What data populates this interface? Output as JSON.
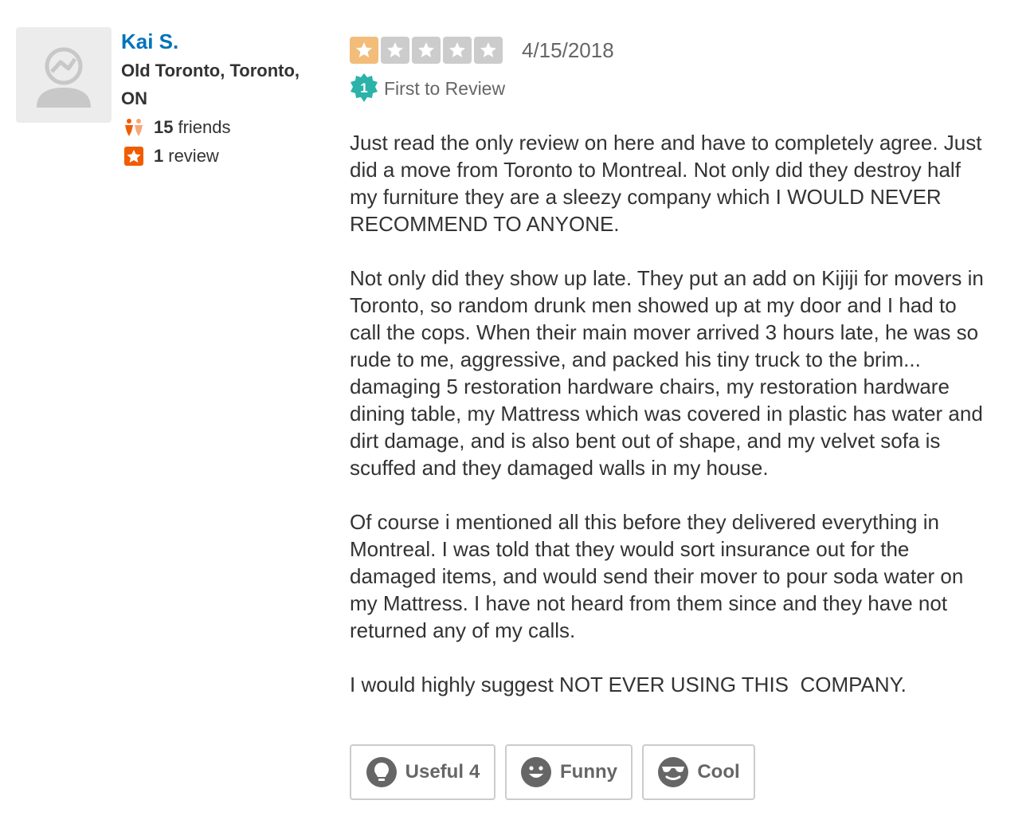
{
  "user": {
    "name": "Kai S.",
    "location": "Old Toronto, Toronto, ON",
    "friends_count": "15",
    "friends_label": "friends",
    "reviews_count": "1",
    "reviews_label": "review"
  },
  "review": {
    "rating": 1,
    "rating_max": 5,
    "date": "4/15/2018",
    "badge_number": "1",
    "badge_label": "First to Review",
    "paragraphs": [
      "Just read the only review on here and have to completely agree. Just did a move from Toronto to Montreal. Not only did they destroy half my furniture they are a sleezy company which I WOULD NEVER RECOMMEND TO ANYONE.",
      "Not only did they show up late. They put an add on Kijiji for movers in Toronto, so random drunk men showed up at my door and I had to call the cops. When their main mover arrived 3 hours late, he was so rude to me, aggressive, and packed his tiny truck to the brim... damaging 5 restoration hardware chairs, my restoration hardware dining table, my Mattress which was covered in plastic has water and dirt damage, and is also bent out of shape, and my velvet sofa is scuffed and they damaged walls in my house.",
      "Of course i mentioned all this before they delivered everything in Montreal. I was told that they would sort insurance out for the damaged items, and would send their mover to pour soda water on my Mattress. I have not heard from them since and they have not returned any of my calls.",
      "I would highly suggest NOT EVER USING THIS  COMPANY."
    ]
  },
  "votes": {
    "useful_label": "Useful",
    "useful_count": "4",
    "funny_label": "Funny",
    "cool_label": "Cool"
  },
  "icons": {
    "avatar": "default-avatar-icon",
    "friends": "friends-icon",
    "reviews": "review-star-icon",
    "badge": "first-to-review-badge-icon",
    "useful": "lightbulb-icon",
    "funny": "smiley-icon",
    "cool": "sunglasses-face-icon"
  },
  "colors": {
    "user_link": "#0073bb",
    "star_on": "#f2bd79",
    "star_off": "#cccccc",
    "friends_icon": "#f15c00",
    "review_icon": "#f15c00",
    "badge": "#2bb3a9",
    "vote_icon": "#666666"
  }
}
